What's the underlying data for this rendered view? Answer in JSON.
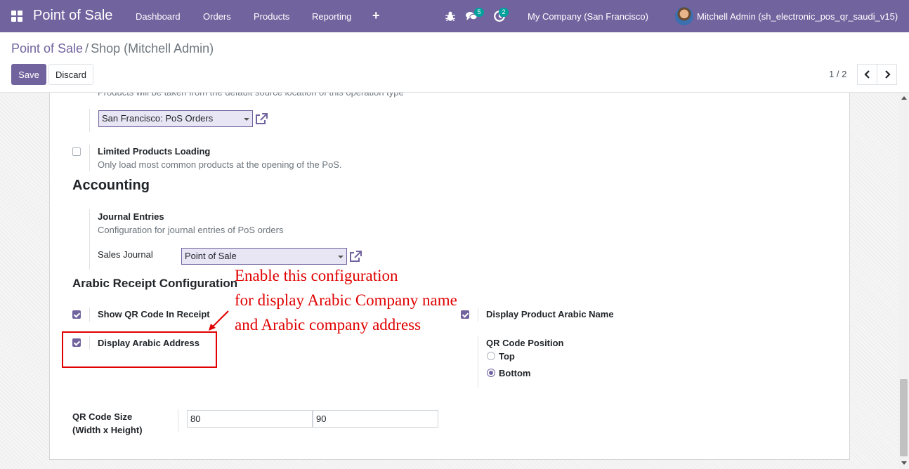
{
  "navbar": {
    "brand": "Point of Sale",
    "menu": [
      "Dashboard",
      "Orders",
      "Products",
      "Reporting"
    ],
    "plus": "+",
    "messages_count": "5",
    "activities_count": "2",
    "company": "My Company (San Francisco)",
    "user": "Mitchell Admin (sh_electronic_pos_qr_saudi_v15)"
  },
  "breadcrumb": {
    "parent": "Point of Sale",
    "separator": "/",
    "current": "Shop (Mitchell Admin)"
  },
  "toolbar": {
    "save_label": "Save",
    "discard_label": "Discard",
    "pager": "1 / 2"
  },
  "form": {
    "operation_type_hint": "Products will be taken from the default source location of this operation type",
    "operation_type_value": "San Francisco: PoS Orders",
    "limited_products": {
      "label": "Limited Products Loading",
      "description": "Only load most common products at the opening of the PoS.",
      "checked": false
    },
    "accounting_title": "Accounting",
    "journal_entries": {
      "label": "Journal Entries",
      "description": "Configuration for journal entries of PoS orders",
      "sales_journal_label": "Sales Journal",
      "sales_journal_value": "Point of Sale"
    },
    "arabic_title": "Arabic Receipt Configuration",
    "show_qr": {
      "label": "Show QR Code In Receipt",
      "checked": true
    },
    "display_product_arabic": {
      "label": "Display Product Arabic Name",
      "checked": true
    },
    "display_arabic_address": {
      "label": "Display Arabic Address",
      "checked": true
    },
    "qr_position": {
      "label": "QR Code Position",
      "options": [
        "Top",
        "Bottom"
      ],
      "selected": "Bottom"
    },
    "qr_size": {
      "label_line1": "QR Code Size",
      "label_line2": "(Width x Height)",
      "width": "80",
      "height": "90"
    }
  },
  "annotation": {
    "line1": "Enable this configuration",
    "line2": "for display Arabic Company name",
    "line3": "and Arabic company address",
    "color": "#e00000"
  },
  "colors": {
    "brand": "#71639e",
    "badge": "#00a09d"
  },
  "icons": [
    "apps-icon",
    "bug-icon",
    "chat-icon",
    "activity-icon",
    "chevron-left-icon",
    "chevron-right-icon",
    "external-link-icon"
  ]
}
